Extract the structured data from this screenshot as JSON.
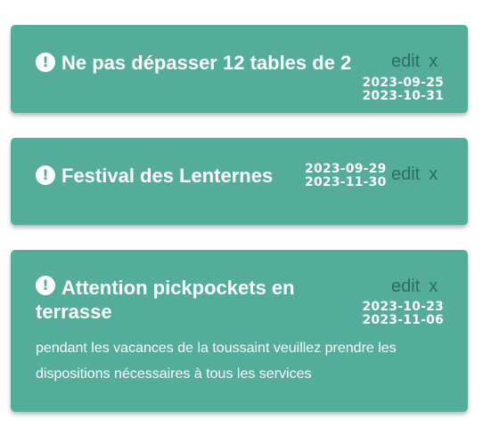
{
  "notes": [
    {
      "title": "Ne pas dépasser 12 tables de 2",
      "start": "2023-09-25",
      "end": "2023-10-31",
      "edit_label": "edit",
      "delete_label": "x",
      "body": ""
    },
    {
      "title": "Festival des Lenternes",
      "start": "2023-09-29",
      "end": "2023-11-30",
      "edit_label": "edit",
      "delete_label": "x",
      "body": ""
    },
    {
      "title": "Attention pickpockets en terrasse",
      "start": "2023-10-23",
      "end": "2023-11-06",
      "edit_label": "edit",
      "delete_label": "x",
      "body": "pendant les vacances de la toussaint veuillez prendre les dispositions nécessaires à tous les services"
    }
  ],
  "icon": {
    "name": "exclamation-circle-icon",
    "glyph": "!"
  },
  "colors": {
    "card_background": "#53ad9a",
    "action_text": "#2f6b5d",
    "text": "#ffffff"
  }
}
